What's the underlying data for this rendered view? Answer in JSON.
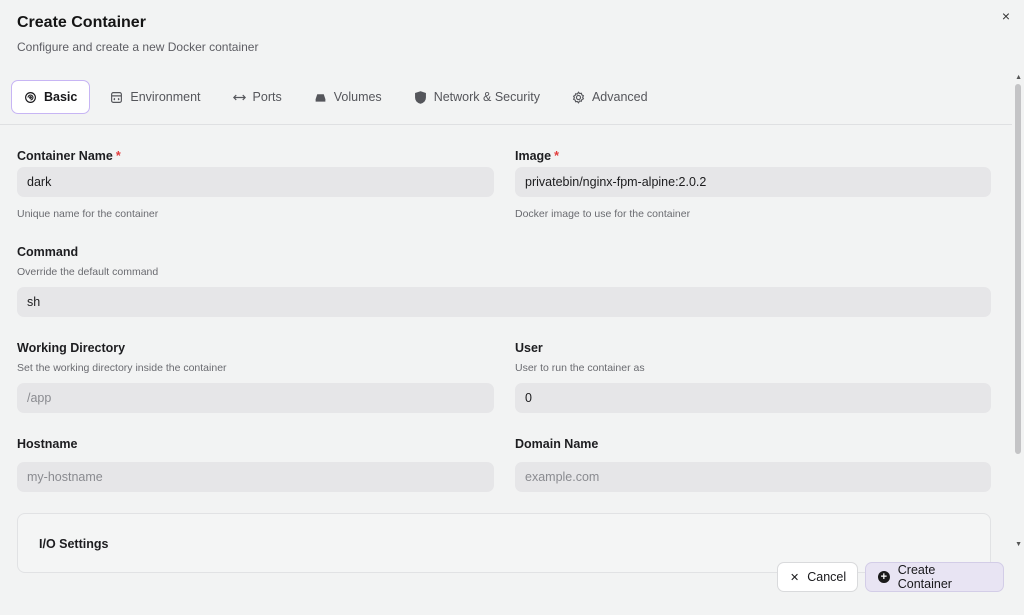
{
  "dialog": {
    "title": "Create Container",
    "subtitle": "Configure and create a new Docker container",
    "close_glyph": "×"
  },
  "tabs": [
    {
      "label": "Basic",
      "icon": "basic-icon",
      "active": true
    },
    {
      "label": "Environment",
      "icon": "environment-icon",
      "active": false
    },
    {
      "label": "Ports",
      "icon": "ports-icon",
      "active": false
    },
    {
      "label": "Volumes",
      "icon": "volumes-icon",
      "active": false
    },
    {
      "label": "Network & Security",
      "icon": "shield-icon",
      "active": false
    },
    {
      "label": "Advanced",
      "icon": "gear-icon",
      "active": false
    }
  ],
  "fields": {
    "container_name": {
      "label": "Container Name",
      "required": "*",
      "value": "dark",
      "placeholder": "",
      "help": "Unique name for the container"
    },
    "image": {
      "label": "Image",
      "required": "*",
      "value": "privatebin/nginx-fpm-alpine:2.0.2",
      "placeholder": "",
      "help": "Docker image to use for the container"
    },
    "command": {
      "label": "Command",
      "help": "Override the default command",
      "value": "sh",
      "placeholder": ""
    },
    "working_directory": {
      "label": "Working Directory",
      "help": "Set the working directory inside the container",
      "value": "",
      "placeholder": "/app"
    },
    "user": {
      "label": "User",
      "help": "User to run the container as",
      "value": "0",
      "placeholder": ""
    },
    "hostname": {
      "label": "Hostname",
      "value": "",
      "placeholder": "my-hostname"
    },
    "domain_name": {
      "label": "Domain Name",
      "value": "",
      "placeholder": "example.com"
    }
  },
  "io_settings": {
    "title": "I/O Settings"
  },
  "footer": {
    "cancel_label": "Cancel",
    "cancel_glyph": "✕",
    "create_label": "Create Container",
    "create_glyph": "+"
  },
  "colors": {
    "accent_border": "#c7b5f4",
    "required": "#e23c3c",
    "input_bg": "#e6e6e8",
    "create_btn_bg": "#e8e4f3"
  }
}
